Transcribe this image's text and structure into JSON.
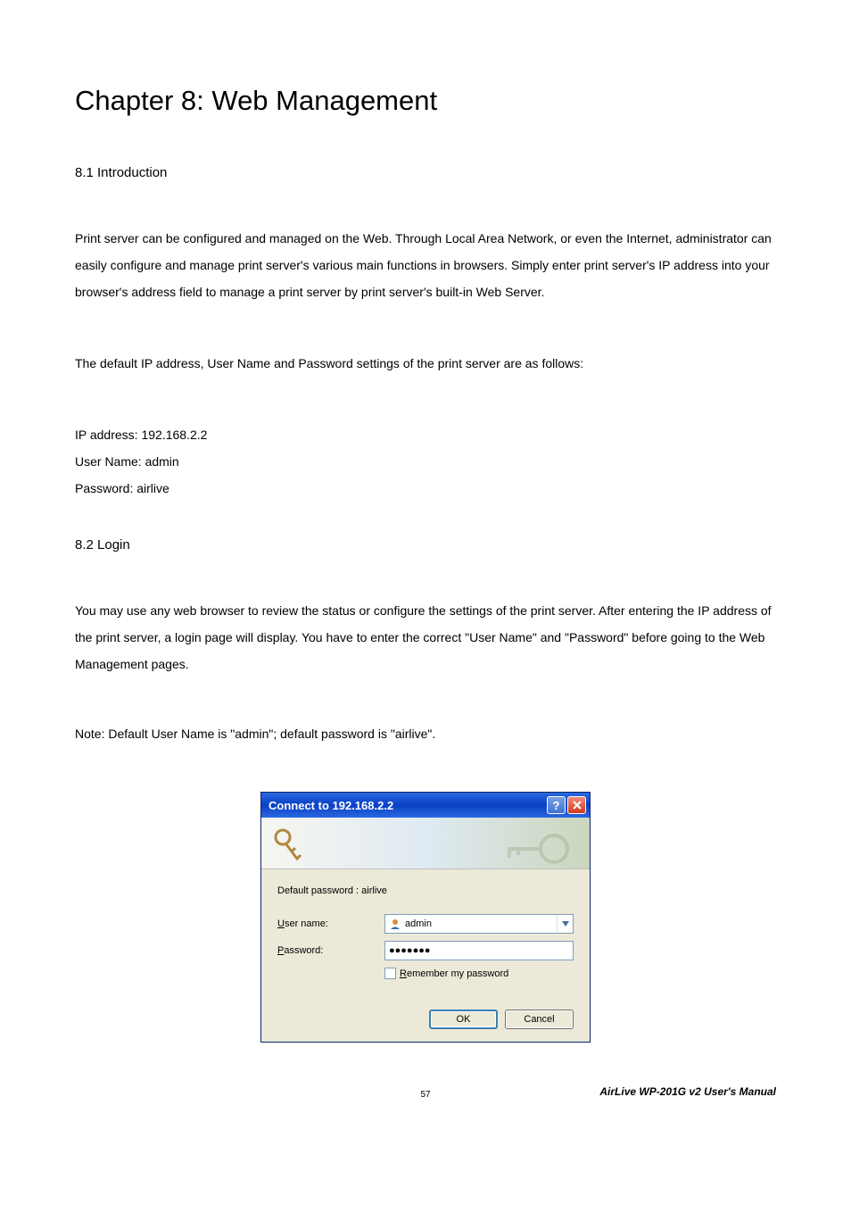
{
  "chapter_title": "Chapter 8: Web Management",
  "section1": {
    "title": "8.1 Introduction",
    "para1": "Print server can be configured and managed on the Web. Through Local Area Network, or even the Internet, administrator can easily configure and manage print server's various main functions in browsers. Simply enter print server's IP address into your browser's address field to manage a print server by print server's built-in Web Server.",
    "para2": "The default IP address, User Name and Password settings of the print server are as follows:",
    "ip_line": "IP address: 192.168.2.2",
    "user_line": "User Name: admin",
    "pass_line": "Password: airlive"
  },
  "section2": {
    "title": "8.2 Login",
    "para1": "You may use any web browser to review the status or configure the settings of the print server. After entering the IP address of the print server, a login page will display. You have to enter the correct \"User Name\" and \"Password\" before going to the Web Management pages.",
    "note": "Note: Default User Name is \"admin\"; default password is \"airlive\"."
  },
  "dialog": {
    "title": "Connect to 192.168.2.2",
    "help_label": "?",
    "close_label": "X",
    "realm": "Default password : airlive",
    "username_label": "User name:",
    "username_value": "admin",
    "password_label": "Password:",
    "password_value": "●●●●●●●",
    "remember_label": "Remember my password",
    "ok_label": "OK",
    "cancel_label": "Cancel"
  },
  "footer": "AirLive WP-201G v2 User's Manual",
  "page_number": "57"
}
